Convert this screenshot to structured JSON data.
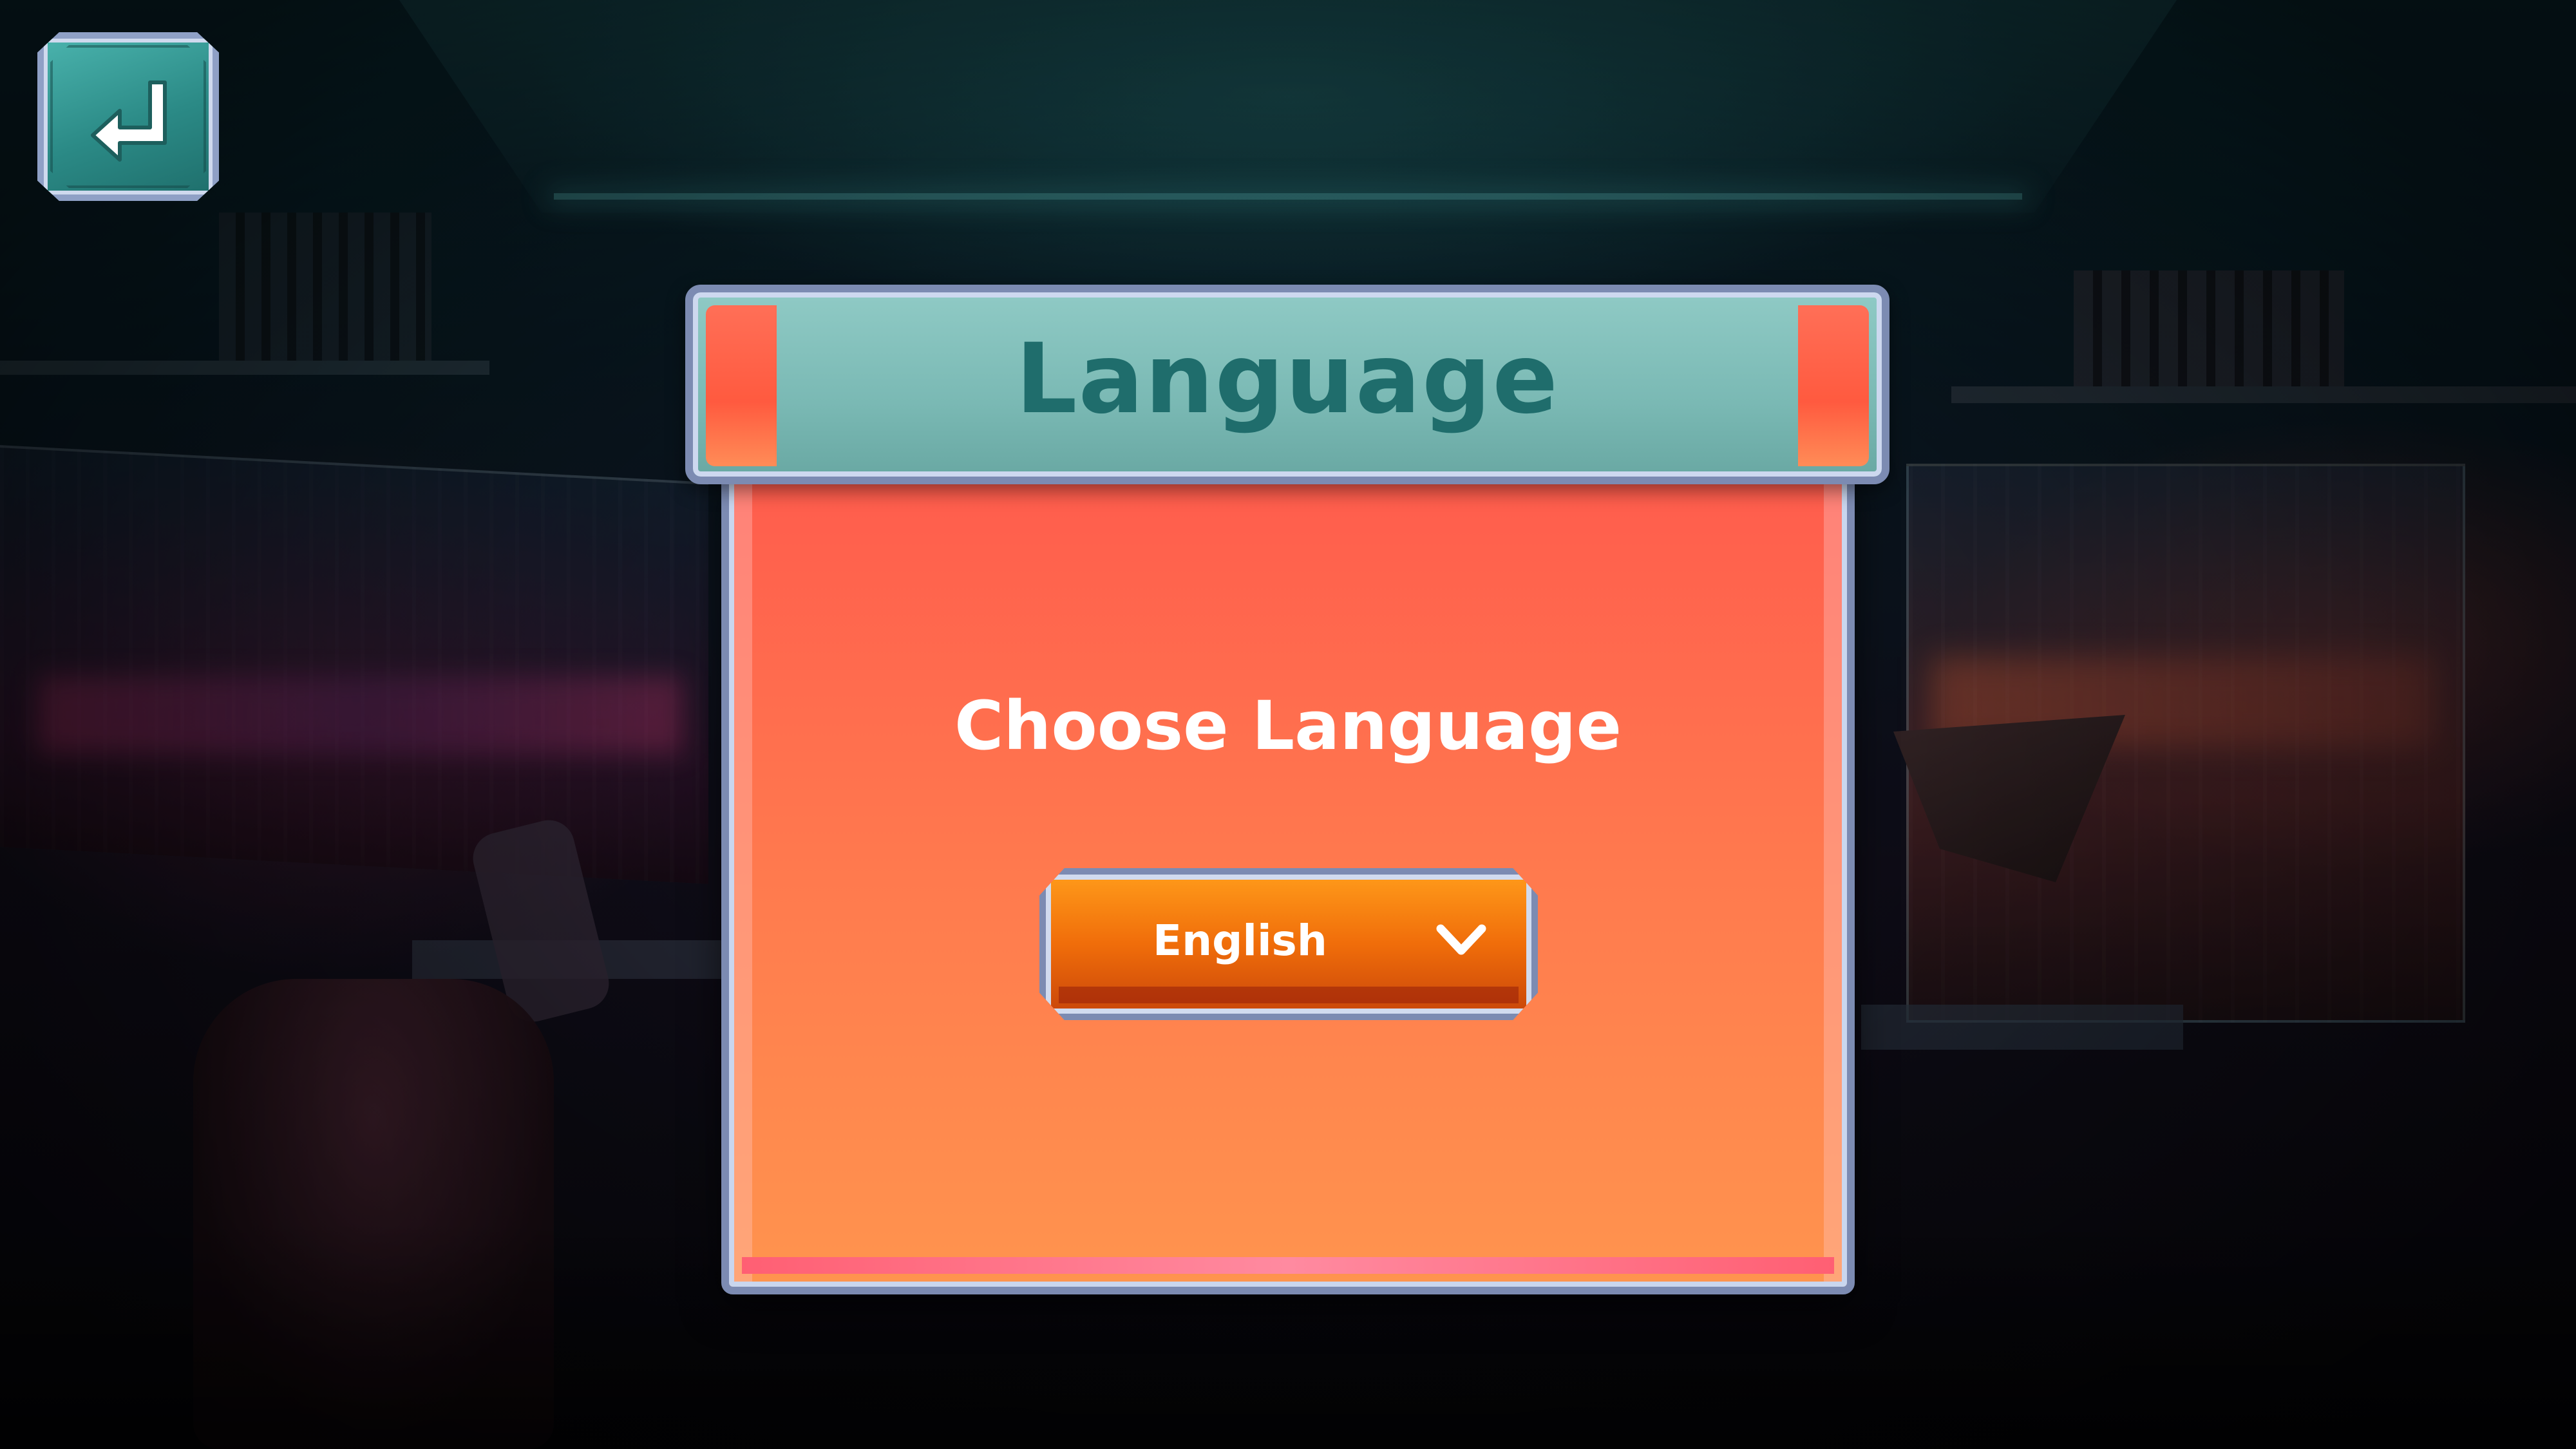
{
  "header": {
    "title": "Language"
  },
  "dialog": {
    "prompt": "Choose Language"
  },
  "language_select": {
    "selected": "English"
  },
  "icons": {
    "back": "return-arrow-icon",
    "dropdown": "chevron-down-icon"
  },
  "colors": {
    "header_teal": "#7ab9b4",
    "title_teal": "#1f6d6c",
    "panel_coral": "#ff6f4e",
    "select_orange": "#f06d0a",
    "frame": "#7c8bb2"
  }
}
